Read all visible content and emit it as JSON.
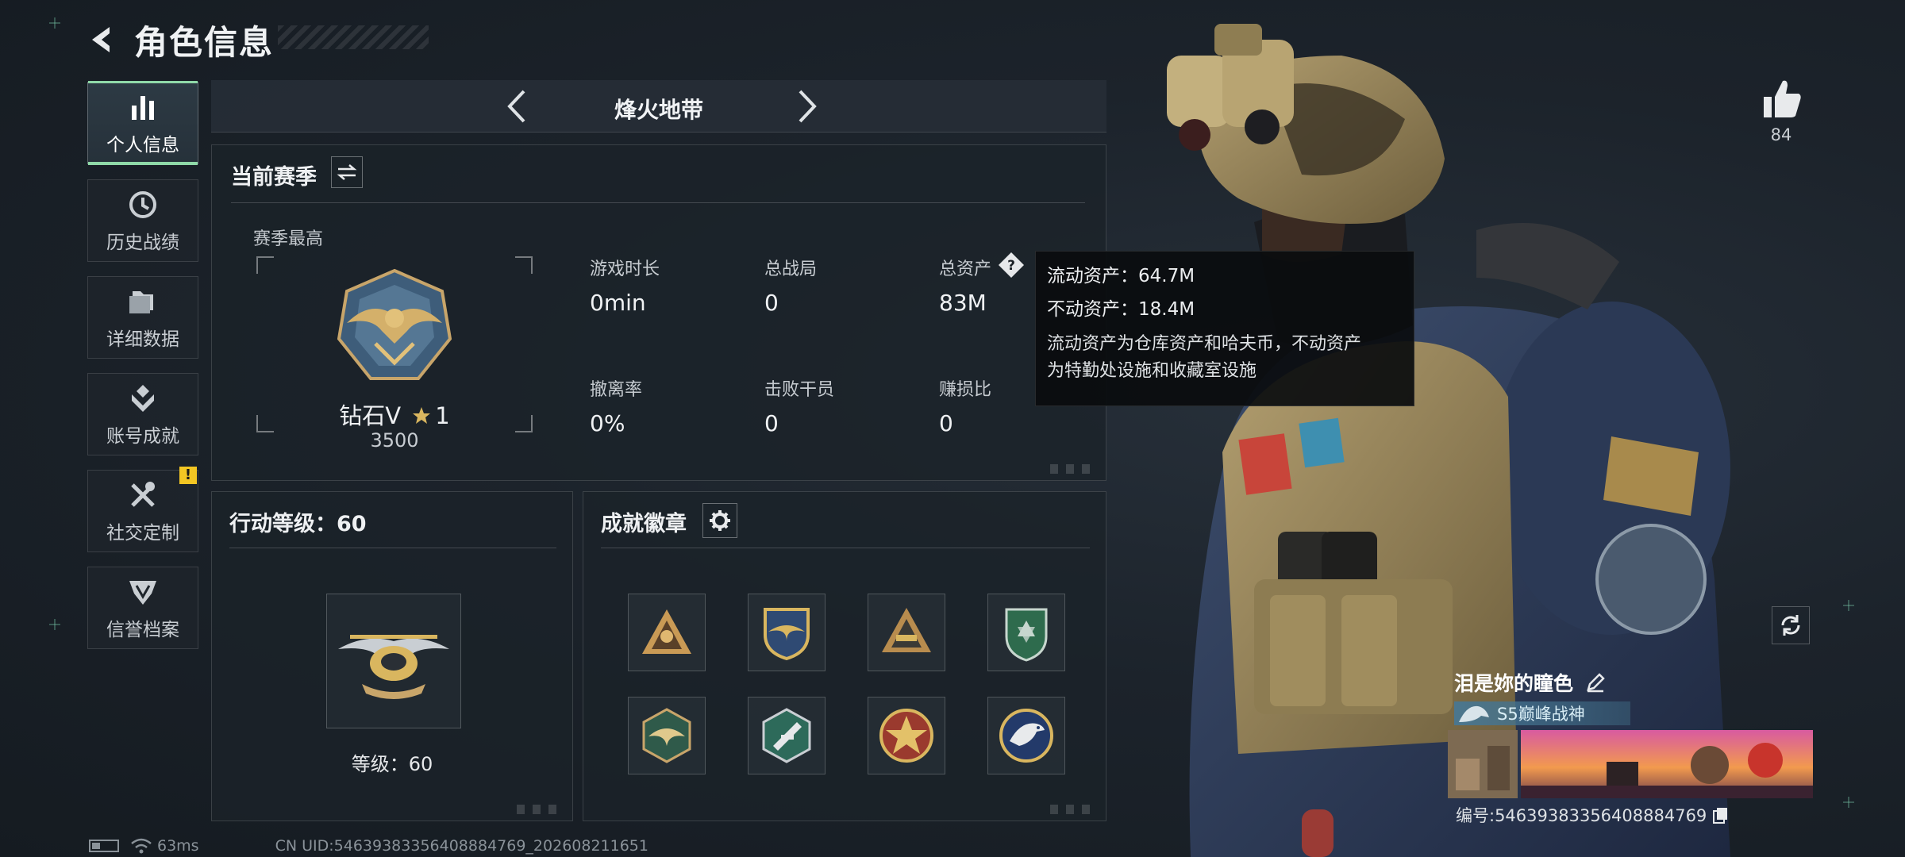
{
  "header": {
    "title": "角色信息"
  },
  "sidebar": {
    "items": [
      {
        "label": "个人信息",
        "icon": "bar-chart-icon",
        "active": true
      },
      {
        "label": "历史战绩",
        "icon": "history-clock-icon",
        "active": false
      },
      {
        "label": "详细数据",
        "icon": "folder-icon",
        "active": false
      },
      {
        "label": "账号成就",
        "icon": "achievement-icon",
        "active": false
      },
      {
        "label": "社交定制",
        "icon": "tools-icon",
        "active": false,
        "badge": "!"
      },
      {
        "label": "信誉档案",
        "icon": "credit-shield-icon",
        "active": false
      }
    ]
  },
  "mode": {
    "title": "烽火地带"
  },
  "season": {
    "title": "当前赛季",
    "best_label": "赛季最高",
    "rank_name": "钻石V",
    "rank_stars": "1",
    "rank_points": "3500",
    "stats": [
      {
        "label": "游戏时长",
        "value": "0min"
      },
      {
        "label": "总战局",
        "value": "0"
      },
      {
        "label": "总资产",
        "value": "83M"
      },
      {
        "label": "撤离率",
        "value": "0%"
      },
      {
        "label": "击败干员",
        "value": "0"
      },
      {
        "label": "赚损比",
        "value": "0"
      }
    ]
  },
  "tooltip": {
    "liquid": "流动资产：64.7M",
    "fixed": "不动资产：18.4M",
    "desc_line1": "流动资产为仓库资产和哈夫币，不动资产",
    "desc_line2": "为特勤处设施和收藏室设施"
  },
  "level": {
    "title": "行动等级：60",
    "caption": "等级：60"
  },
  "achievements": {
    "title": "成就徽章",
    "medals": [
      "triangle-squad-medal-icon",
      "eagle-shield-medal-icon",
      "triangle-badge-medal-icon",
      "green-shield-medal-icon",
      "winged-hex-medal-icon",
      "hex-weapon-medal-icon",
      "red-star-medal-icon",
      "eagle-round-medal-icon"
    ]
  },
  "profile": {
    "likes": "84",
    "name": "泪是妳的瞳色",
    "title": "S5巅峰战神",
    "uid": "编号:5463938335640888476​9"
  },
  "footer": {
    "latency": "63ms",
    "uid": "CN UID:5463938335640888476​9_202608211651"
  },
  "colors": {
    "accent": "#8fd9a8",
    "badge": "#f3c623",
    "background": "#1c232b"
  }
}
